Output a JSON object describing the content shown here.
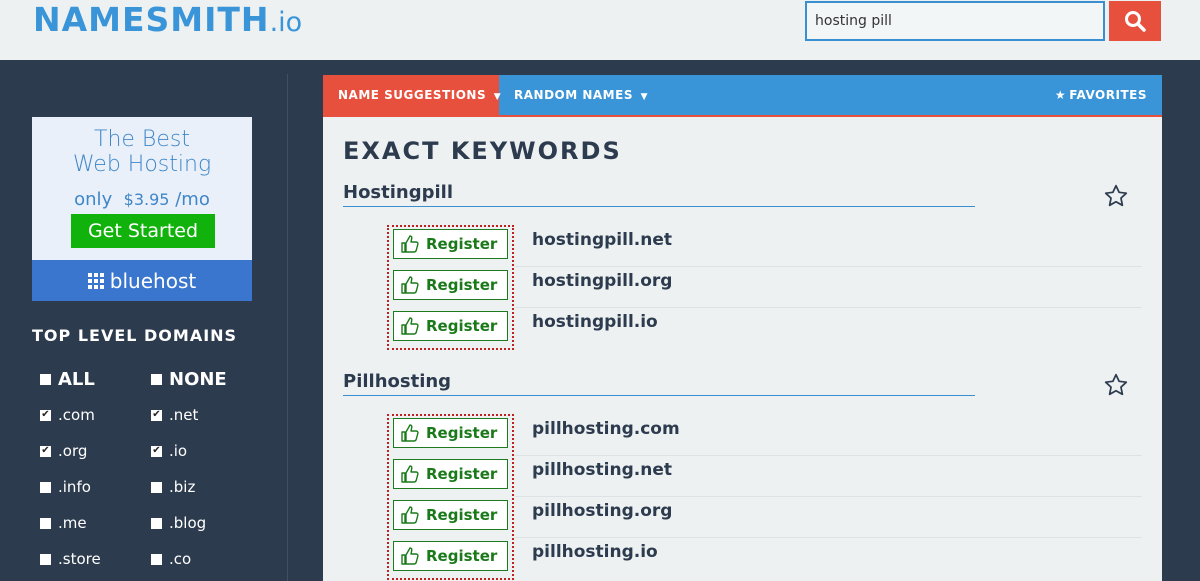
{
  "header": {
    "logo_main": "NAMESMITH",
    "logo_tld": ".io",
    "search_value": "hosting pill",
    "search_icon": "search-icon"
  },
  "ad": {
    "line1": "The Best",
    "line2": "Web Hosting",
    "price_prefix": "only",
    "price": "$3.95",
    "price_suffix": "/mo",
    "cta": "Get Started",
    "brand": "bluehost"
  },
  "tld": {
    "title": "TOP LEVEL DOMAINS",
    "all": {
      "label": "ALL",
      "checked": false
    },
    "none": {
      "label": "NONE",
      "checked": false
    },
    "items": [
      {
        "label": ".com",
        "checked": true
      },
      {
        "label": ".net",
        "checked": true
      },
      {
        "label": ".org",
        "checked": true
      },
      {
        "label": ".io",
        "checked": true
      },
      {
        "label": ".info",
        "checked": false
      },
      {
        "label": ".biz",
        "checked": false
      },
      {
        "label": ".me",
        "checked": false
      },
      {
        "label": ".blog",
        "checked": false
      },
      {
        "label": ".store",
        "checked": false
      },
      {
        "label": ".co",
        "checked": false
      }
    ]
  },
  "tabs": {
    "suggestions": "NAME SUGGESTIONS",
    "random": "RANDOM NAMES",
    "favorites": "FAVORITES"
  },
  "main": {
    "heading": "EXACT KEYWORDS",
    "register_label": "Register",
    "groups": [
      {
        "title": "Hostingpill",
        "domains": [
          "hostingpill.net",
          "hostingpill.org",
          "hostingpill.io"
        ]
      },
      {
        "title": "Pillhosting",
        "domains": [
          "pillhosting.com",
          "pillhosting.net",
          "pillhosting.org",
          "pillhosting.io"
        ]
      }
    ]
  },
  "colors": {
    "accent_blue": "#3a95d8",
    "accent_red": "#e8503e",
    "sidebar_bg": "#2d3b4e",
    "register_green": "#1a7a1a"
  }
}
